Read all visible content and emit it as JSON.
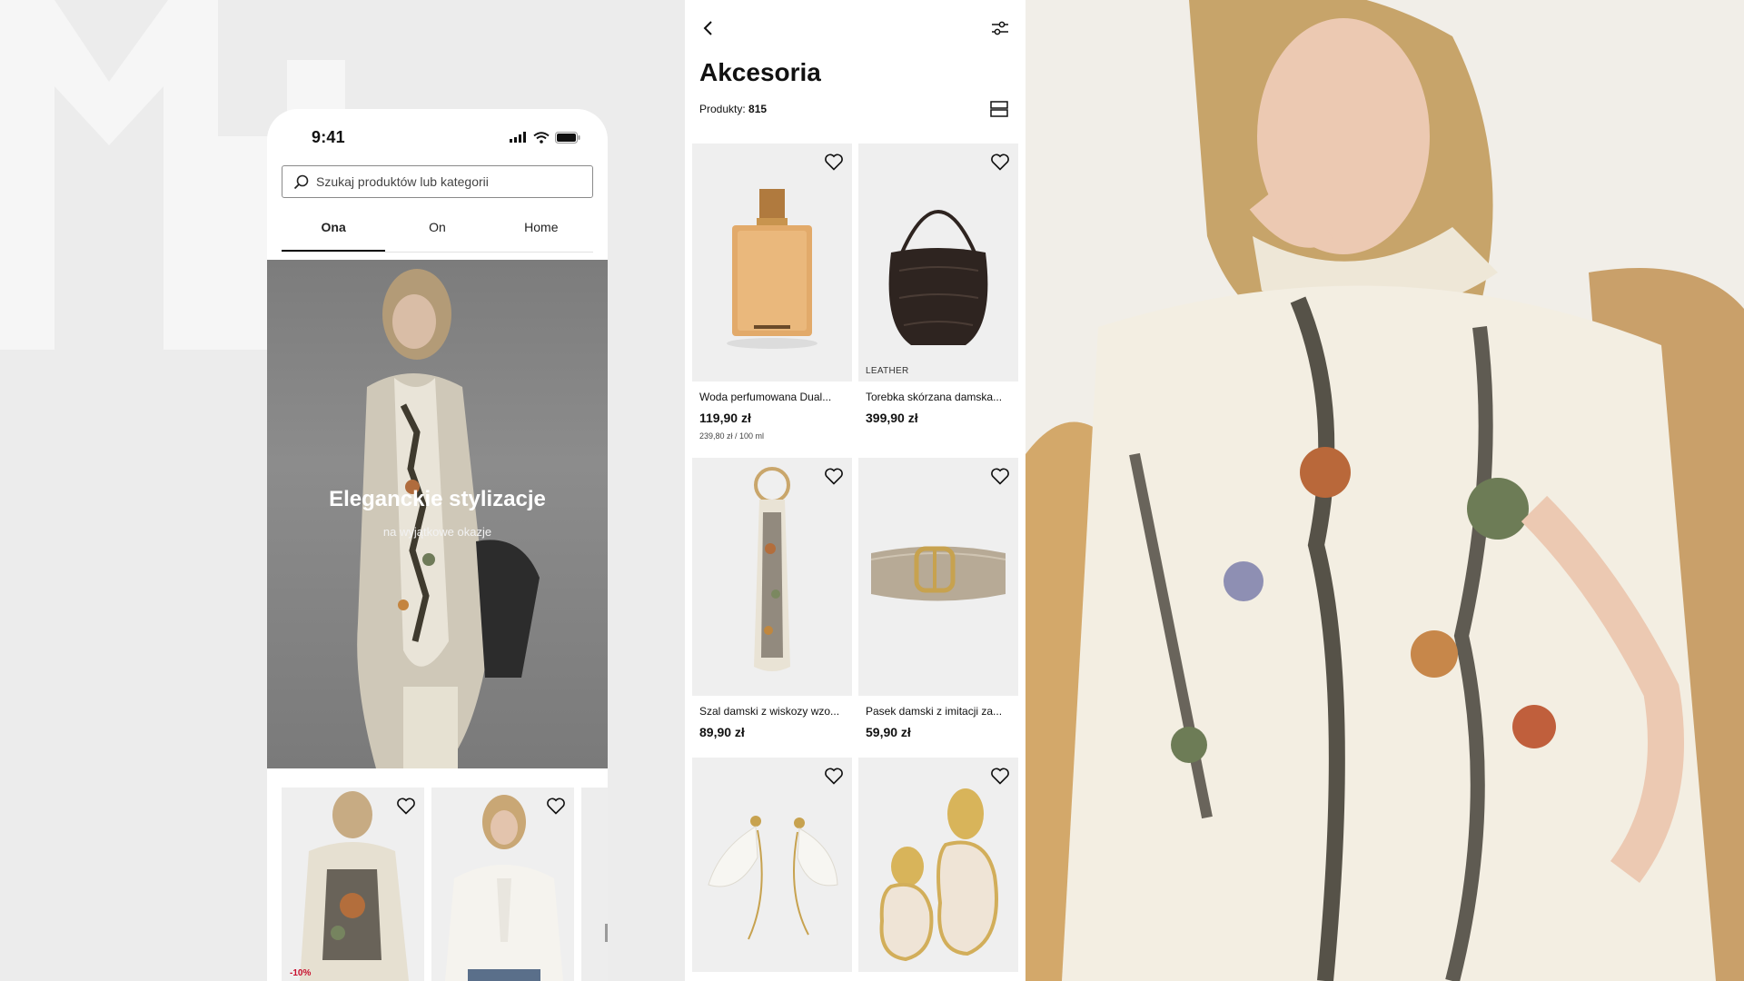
{
  "status_bar": {
    "time": "9:41"
  },
  "search": {
    "placeholder": "Szukaj produktów lub kategorii"
  },
  "gender_tabs": [
    {
      "label": "Ona",
      "active": true
    },
    {
      "label": "On",
      "active": false
    },
    {
      "label": "Home",
      "active": false
    }
  ],
  "hero": {
    "title": "Eleganckie stylizacje",
    "subtitle": "na wyjątkowe okazje"
  },
  "mini_products": [
    {
      "badge": "-10%"
    },
    {
      "badge": ""
    }
  ],
  "catalog": {
    "title": "Akcesoria",
    "count_label": "Produkty:",
    "count_value": "815",
    "products": [
      {
        "name": "Woda perfumowana Dual...",
        "price": "119,90 zł",
        "unit_price": "239,80 zł / 100 ml",
        "tag": "",
        "icon": "perfume-bottle"
      },
      {
        "name": "Torebka skórzana damska...",
        "price": "399,90 zł",
        "unit_price": "",
        "tag": "LEATHER",
        "icon": "handbag"
      },
      {
        "name": "Szal damski z wiskozy wzo...",
        "price": "89,90 zł",
        "unit_price": "",
        "tag": "",
        "icon": "scarf"
      },
      {
        "name": "Pasek damski z imitacji za...",
        "price": "59,90 zł",
        "unit_price": "",
        "tag": "",
        "icon": "belt"
      },
      {
        "name": "",
        "price": "",
        "unit_price": "",
        "tag": "",
        "icon": "earrings-petal"
      },
      {
        "name": "",
        "price": "",
        "unit_price": "",
        "tag": "",
        "icon": "earrings-pearl"
      }
    ]
  },
  "colors": {
    "accent": "#111111",
    "discount": "#c8102e",
    "background": "#ececec"
  }
}
